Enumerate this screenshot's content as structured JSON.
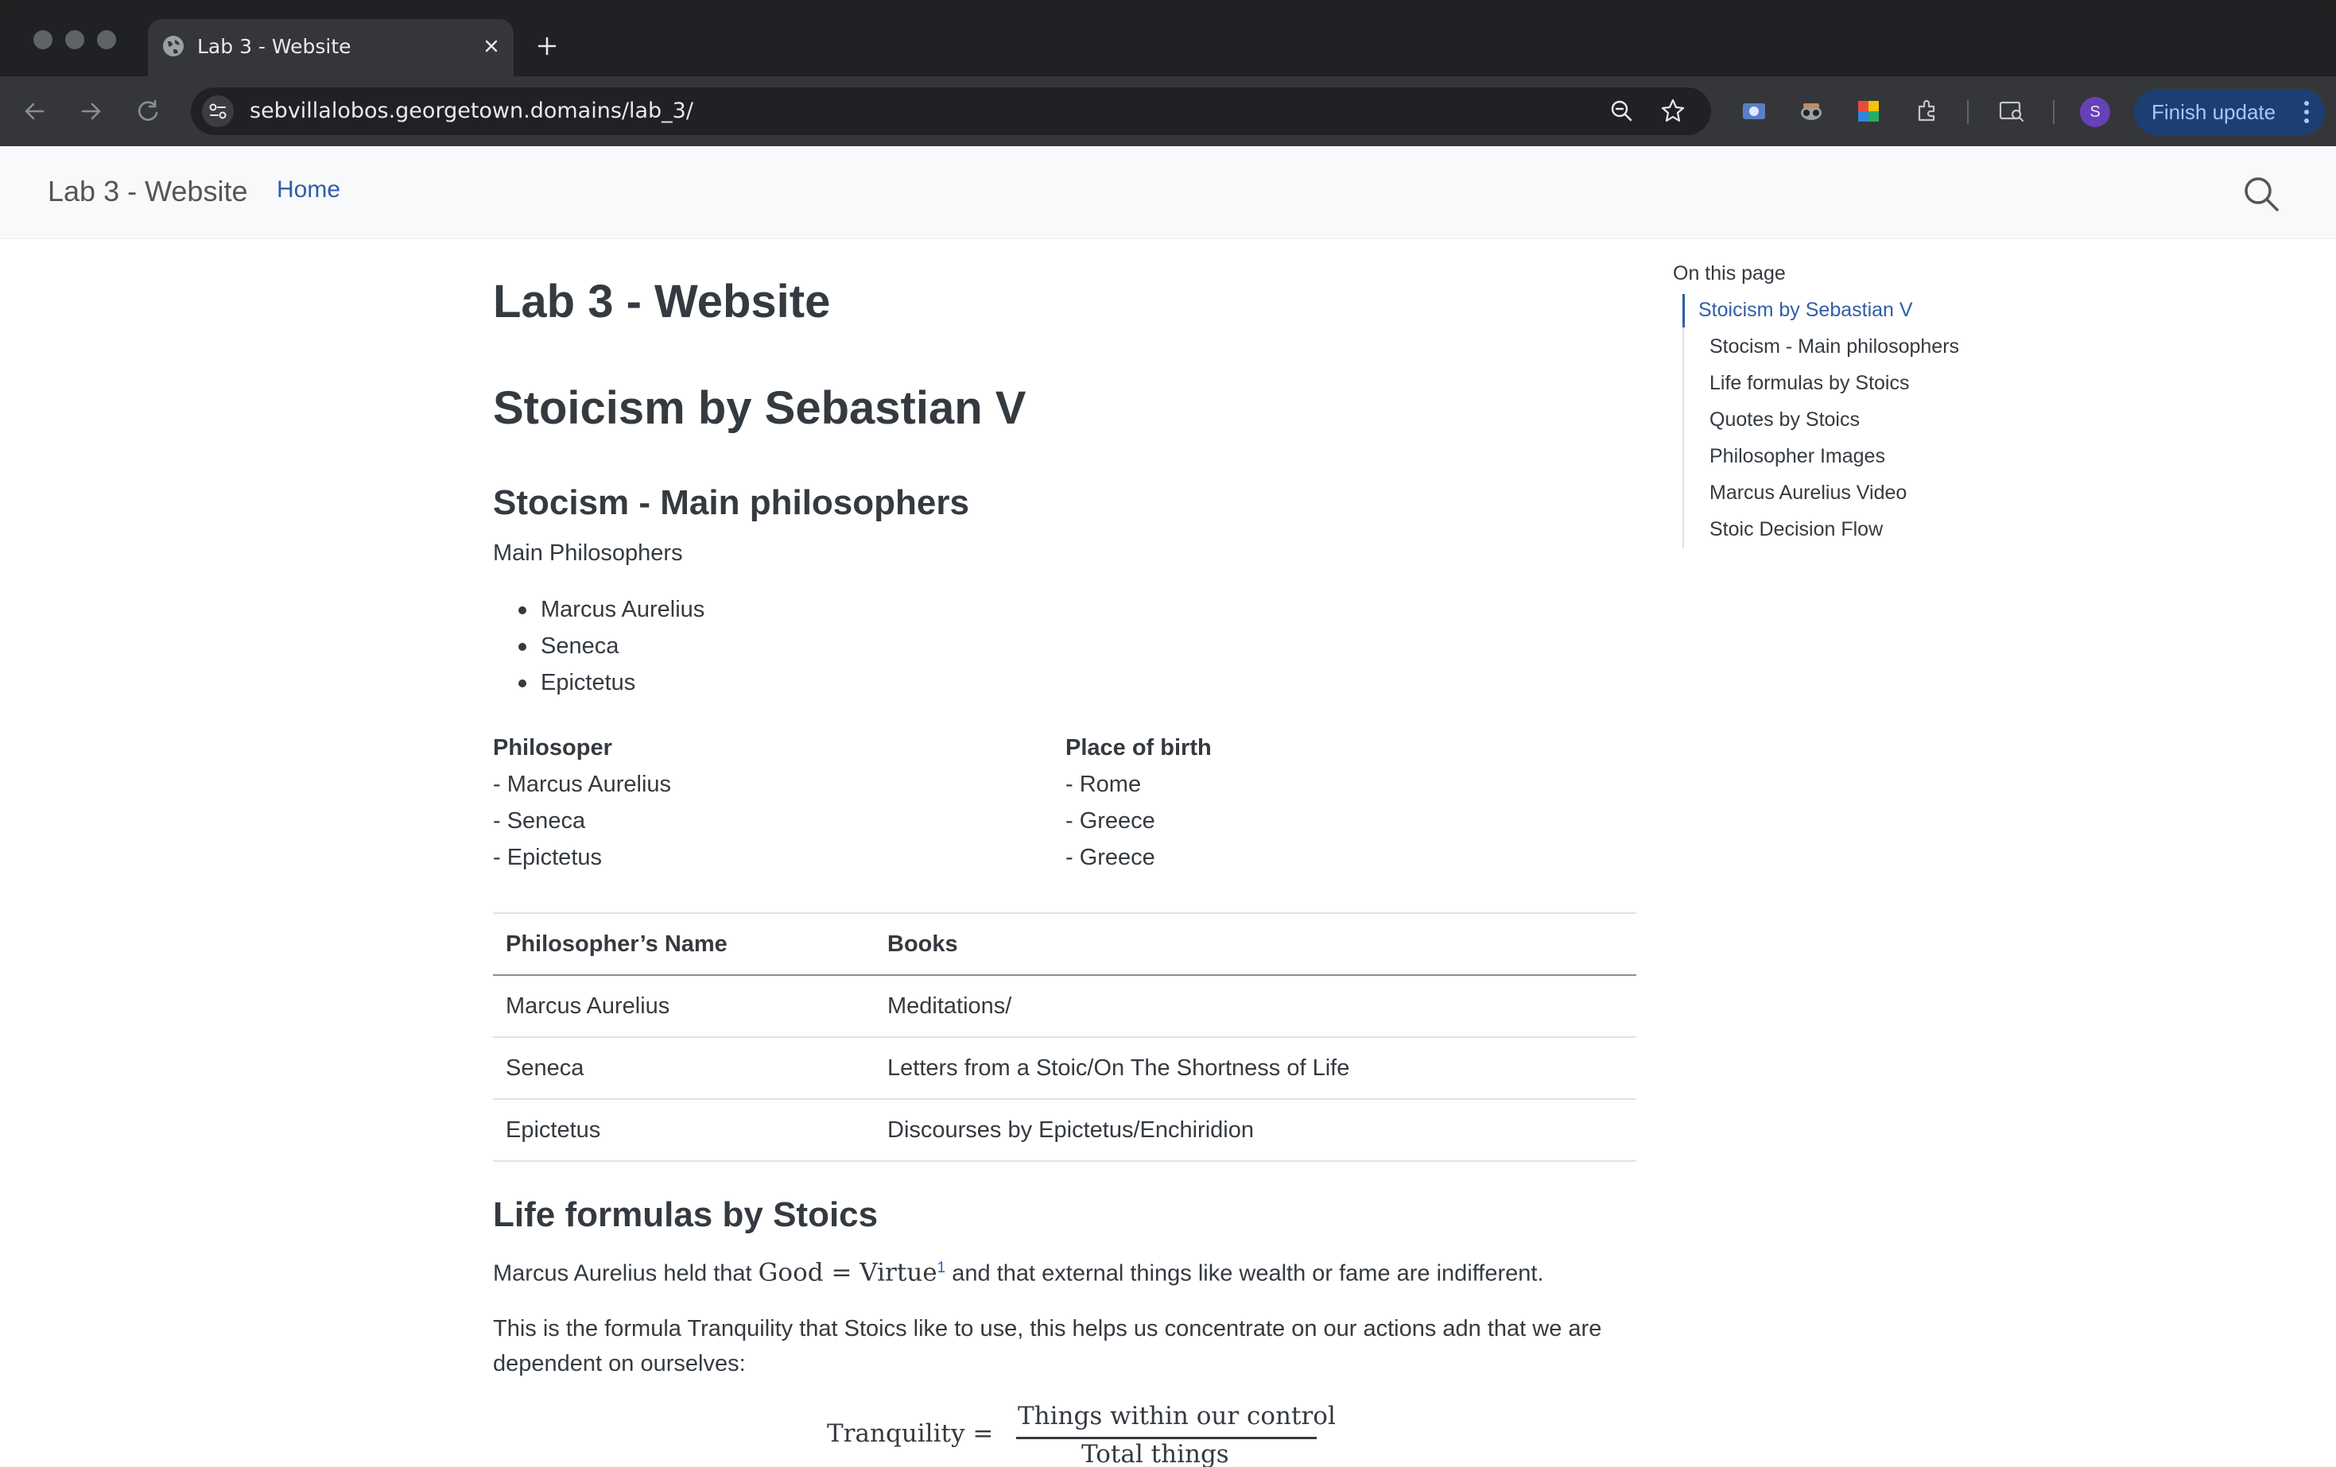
{
  "browser": {
    "tab_title": "Lab 3 - Website",
    "url": "sebvillalobos.georgetown.domains/lab_3/",
    "profile_initial": "S",
    "finish_update_label": "Finish update"
  },
  "navbar": {
    "brand": "Lab 3 - Website",
    "links": [
      {
        "label": "Home"
      }
    ]
  },
  "content": {
    "page_title": "Lab 3 - Website",
    "h1": "Stoicism by Sebastian V",
    "section1": {
      "title": "Stocism - Main philosophers",
      "intro": "Main Philosophers",
      "bullets": [
        "Marcus Aurelius",
        "Seneca",
        "Epictetus"
      ]
    },
    "columns": {
      "left": {
        "header": "Philosoper",
        "items": [
          "- Marcus Aurelius",
          "- Seneca",
          "- Epictetus"
        ]
      },
      "right": {
        "header": "Place of birth",
        "items": [
          "- Rome",
          "- Greece",
          "- Greece"
        ]
      }
    },
    "table": {
      "headers": [
        "Philosopher’s Name",
        "Books"
      ],
      "rows": [
        [
          "Marcus Aurelius",
          "Meditations/"
        ],
        [
          "Seneca",
          "Letters from a Stoic/On The Shortness of Life"
        ],
        [
          "Epictetus",
          "Discourses by Epictetus/Enchiridion"
        ]
      ]
    },
    "section2": {
      "title": "Life formulas by Stoics",
      "p1_before": "Marcus Aurelius held that ",
      "p1_math": "Good = Virtue",
      "p1_footnote": "1",
      "p1_after": " and that external things like wealth or fame are indifferent.",
      "p2_line1": "This is the formula Tranquility that Stoics like to use, this helps us concentrate on our actions adn that we are",
      "p2_line2": "dependent on ourselves:",
      "formula": {
        "lhs": "Tranquility =",
        "numerator": "Things within our control",
        "denominator": "Total things"
      }
    }
  },
  "toc": {
    "heading": "On this page",
    "items": [
      {
        "label": "Stoicism by Sebastian V",
        "active": true
      },
      {
        "label": "Stocism - Main philosophers"
      },
      {
        "label": "Life formulas by Stoics"
      },
      {
        "label": "Quotes by Stoics"
      },
      {
        "label": "Philosopher Images"
      },
      {
        "label": "Marcus Aurelius Video"
      },
      {
        "label": "Stoic Decision Flow"
      }
    ]
  },
  "colors": {
    "link": "#2f5ea8",
    "text": "#343a40",
    "navbar_bg": "#f8f9fa",
    "chrome_bg": "#35363a",
    "finish_update_bg": "#1c3f73"
  }
}
